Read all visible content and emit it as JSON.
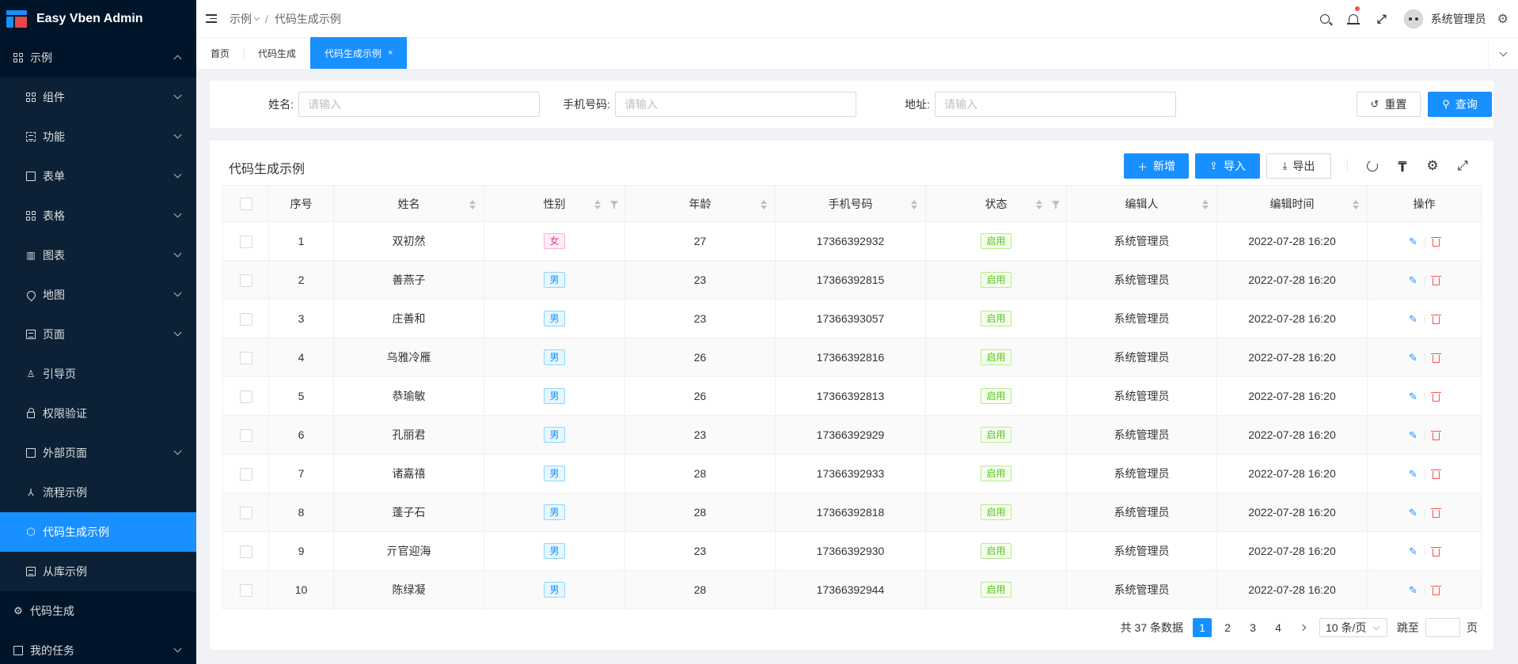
{
  "app": {
    "title": "Easy Vben Admin"
  },
  "sidebar": {
    "items": [
      {
        "label": "示例",
        "icon": "grid-icon",
        "level": "top",
        "expanded": true
      },
      {
        "label": "组件",
        "icon": "grid-icon",
        "level": "sub",
        "has_children": true
      },
      {
        "label": "功能",
        "icon": "scan-icon",
        "level": "sub",
        "has_children": true
      },
      {
        "label": "表单",
        "icon": "form-edit-icon",
        "level": "sub",
        "has_children": true
      },
      {
        "label": "表格",
        "icon": "table-icon",
        "level": "sub",
        "has_children": true
      },
      {
        "label": "图表",
        "icon": "bar-chart-icon",
        "level": "sub",
        "has_children": true
      },
      {
        "label": "地图",
        "icon": "map-pin-icon",
        "level": "sub",
        "has_children": true
      },
      {
        "label": "页面",
        "icon": "page-icon",
        "level": "sub",
        "has_children": true
      },
      {
        "label": "引导页",
        "icon": "bell-guide-icon",
        "level": "sub",
        "has_children": false
      },
      {
        "label": "权限验证",
        "icon": "lock-icon",
        "level": "sub",
        "has_children": false
      },
      {
        "label": "外部页面",
        "icon": "external-icon",
        "level": "sub",
        "has_children": true
      },
      {
        "label": "流程示例",
        "icon": "flow-icon",
        "level": "sub",
        "has_children": false
      },
      {
        "label": "代码生成示例",
        "icon": "cube-icon",
        "level": "sub",
        "has_children": false,
        "active": true
      },
      {
        "label": "从库示例",
        "icon": "database-icon",
        "level": "sub",
        "has_children": false
      },
      {
        "label": "代码生成",
        "icon": "code-gen-icon",
        "level": "top",
        "has_children": false
      },
      {
        "label": "我的任务",
        "icon": "task-icon",
        "level": "top",
        "has_children": true
      }
    ]
  },
  "header": {
    "breadcrumb": [
      "示例",
      "代码生成示例"
    ],
    "user_name": "系统管理员"
  },
  "tabs": [
    {
      "label": "首页",
      "active": false
    },
    {
      "label": "代码生成",
      "active": false
    },
    {
      "label": "代码生成示例",
      "active": true,
      "close": "×"
    }
  ],
  "search": {
    "name_label": "姓名:",
    "name_placeholder": "请输入",
    "phone_label": "手机号码:",
    "phone_placeholder": "请输入",
    "address_label": "地址:",
    "address_placeholder": "请输入",
    "reset": "重置",
    "query": "查询"
  },
  "table": {
    "title": "代码生成示例",
    "add": "新增",
    "import": "导入",
    "export": "导出",
    "columns": [
      "序号",
      "姓名",
      "性别",
      "年龄",
      "手机号码",
      "状态",
      "编辑人",
      "编辑时间",
      "操作"
    ],
    "rows": [
      {
        "index": "1",
        "name": "双初然",
        "gender": "女",
        "age": "27",
        "phone": "17366392932",
        "status": "启用",
        "editor": "系统管理员",
        "time": "2022-07-28 16:20"
      },
      {
        "index": "2",
        "name": "善燕子",
        "gender": "男",
        "age": "23",
        "phone": "17366392815",
        "status": "启用",
        "editor": "系统管理员",
        "time": "2022-07-28 16:20"
      },
      {
        "index": "3",
        "name": "庄善和",
        "gender": "男",
        "age": "23",
        "phone": "17366393057",
        "status": "启用",
        "editor": "系统管理员",
        "time": "2022-07-28 16:20"
      },
      {
        "index": "4",
        "name": "乌雅冷雁",
        "gender": "男",
        "age": "26",
        "phone": "17366392816",
        "status": "启用",
        "editor": "系统管理员",
        "time": "2022-07-28 16:20"
      },
      {
        "index": "5",
        "name": "恭瑜敏",
        "gender": "男",
        "age": "26",
        "phone": "17366392813",
        "status": "启用",
        "editor": "系统管理员",
        "time": "2022-07-28 16:20"
      },
      {
        "index": "6",
        "name": "孔丽君",
        "gender": "男",
        "age": "23",
        "phone": "17366392929",
        "status": "启用",
        "editor": "系统管理员",
        "time": "2022-07-28 16:20"
      },
      {
        "index": "7",
        "name": "诸嘉禧",
        "gender": "男",
        "age": "28",
        "phone": "17366392933",
        "status": "启用",
        "editor": "系统管理员",
        "time": "2022-07-28 16:20"
      },
      {
        "index": "8",
        "name": "蓬子石",
        "gender": "男",
        "age": "28",
        "phone": "17366392818",
        "status": "启用",
        "editor": "系统管理员",
        "time": "2022-07-28 16:20"
      },
      {
        "index": "9",
        "name": "亓官迎海",
        "gender": "男",
        "age": "23",
        "phone": "17366392930",
        "status": "启用",
        "editor": "系统管理员",
        "time": "2022-07-28 16:20"
      },
      {
        "index": "10",
        "name": "陈绿凝",
        "gender": "男",
        "age": "28",
        "phone": "17366392944",
        "status": "启用",
        "editor": "系统管理员",
        "time": "2022-07-28 16:20"
      }
    ]
  },
  "pagination": {
    "total_text": "共 37 条数据",
    "pages": [
      "1",
      "2",
      "3",
      "4"
    ],
    "current": "1",
    "page_size": "10 条/页",
    "jump_label": "跳至",
    "page_suffix": "页"
  },
  "colors": {
    "primary": "#1890ff",
    "sidebar_bg": "#001529",
    "danger": "#ff4d4f",
    "success": "#52c41a",
    "female": "#eb2f96"
  }
}
